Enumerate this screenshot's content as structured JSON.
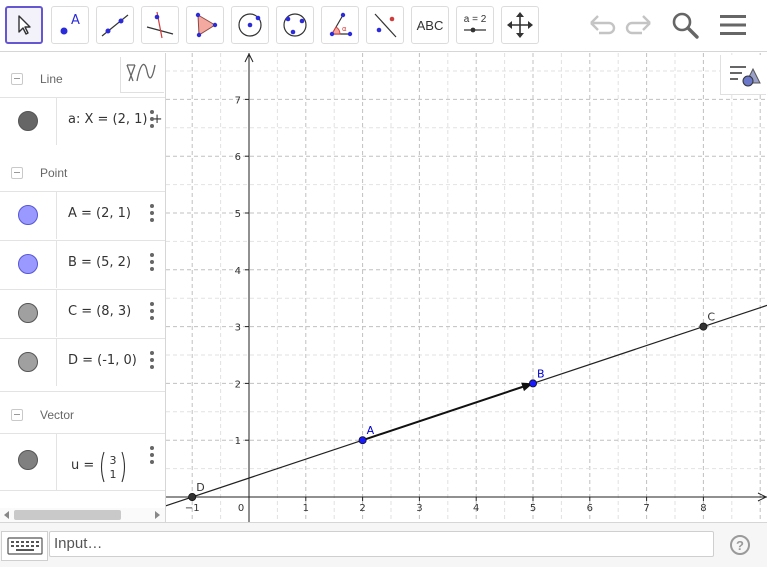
{
  "toolbar": {
    "tools": [
      {
        "name": "move-tool",
        "icon": "arrow-cursor-icon",
        "selected": true
      },
      {
        "name": "point-tool",
        "icon": "point-icon",
        "label": "A"
      },
      {
        "name": "line-tool",
        "icon": "line-through-two-points-icon"
      },
      {
        "name": "perpendicular-line-tool",
        "icon": "perpendicular-line-icon"
      },
      {
        "name": "polygon-tool",
        "icon": "polygon-icon"
      },
      {
        "name": "circle-center-point-tool",
        "icon": "circle-center-icon"
      },
      {
        "name": "circle-three-points-tool",
        "icon": "circle-three-points-icon"
      },
      {
        "name": "angle-tool",
        "icon": "angle-icon"
      },
      {
        "name": "reflect-tool",
        "icon": "reflect-about-line-icon"
      },
      {
        "name": "text-tool",
        "icon": "text-icon",
        "label": "ABC"
      },
      {
        "name": "slider-tool",
        "icon": "slider-icon",
        "label": "a = 2"
      },
      {
        "name": "move-graphics-tool",
        "icon": "move-graphics-icon"
      }
    ],
    "right_icons": [
      "undo-icon",
      "redo-icon",
      "search-icon",
      "menu-icon"
    ]
  },
  "algebra": {
    "groups": [
      {
        "label": "Line",
        "items": [
          {
            "text": "a: X = (2, 1) +",
            "color": "#666666"
          }
        ]
      },
      {
        "label": "Point",
        "items": [
          {
            "text": "A = (2, 1)",
            "color": "#9999ff"
          },
          {
            "text": "B = (5, 2)",
            "color": "#9999ff"
          },
          {
            "text": "C = (8, 3)",
            "color": "#a0a0a0"
          },
          {
            "text": "D = (-1, 0)",
            "color": "#a0a0a0"
          }
        ]
      },
      {
        "label": "Vector",
        "items": [
          {
            "text_prefix": "u =",
            "vector": [
              "3",
              "1"
            ],
            "color": "#808080"
          }
        ]
      }
    ]
  },
  "graphics": {
    "x_ticks": [
      "−1",
      "0",
      "1",
      "2",
      "3",
      "4",
      "5",
      "6",
      "7",
      "8"
    ],
    "y_ticks": [
      "1",
      "2",
      "3",
      "4",
      "5",
      "6",
      "7"
    ],
    "points": [
      {
        "label": "A",
        "x": 2,
        "y": 1,
        "color": "#1a1aff",
        "label_color": "#0000cc"
      },
      {
        "label": "B",
        "x": 5,
        "y": 2,
        "color": "#1a1aff",
        "label_color": "#0000cc"
      },
      {
        "label": "C",
        "x": 8,
        "y": 3,
        "color": "#333333",
        "label_color": "#333333"
      },
      {
        "label": "D",
        "x": -1,
        "y": 0,
        "color": "#333333",
        "label_color": "#333333"
      }
    ],
    "line": {
      "point": [
        2,
        1
      ],
      "direction": [
        3,
        1
      ]
    },
    "vector": {
      "from": [
        2,
        1
      ],
      "to": [
        5,
        2
      ]
    }
  },
  "inputbar": {
    "placeholder": "Input…",
    "help": "?"
  }
}
